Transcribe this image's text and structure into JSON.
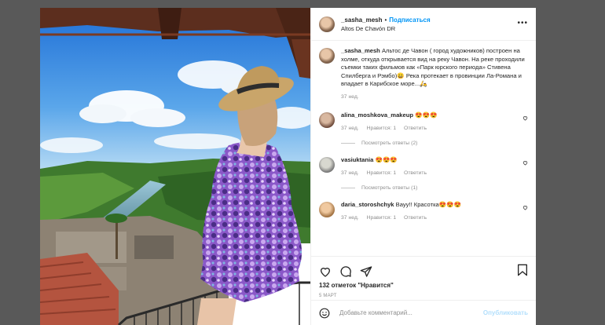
{
  "post": {
    "username": "_sasha_mesh",
    "follow_label": "Подписаться",
    "location": "Altos De Chavón DR",
    "more_icon": "more-icon"
  },
  "caption": {
    "username": "_sasha_mesh",
    "text": "Альтос де Чавон ( город художников) построен на холме, откуда открывается вид на реку Чавон. На реке проходили съемки таких фильмов как «Парк юрского периода» Стивена Спилберга и Рэмбо)😄 Река протекает в провинции Ла-Романа и впадает в Карибское море...🛵",
    "time": "37 нед."
  },
  "comments": [
    {
      "username": "alina_moshkova_makeup",
      "text": "😍😍😍",
      "time": "37 нед.",
      "likes": "Нравится: 1",
      "reply": "Ответить",
      "replies": "Посмотреть ответы (2)"
    },
    {
      "username": "vasiuktania",
      "text": "😍😍😍",
      "time": "37 нед.",
      "likes": "Нравится: 1",
      "reply": "Ответить",
      "replies": "Посмотреть ответы (1)"
    },
    {
      "username": "daria_storoshchyk",
      "text": "Вауу!! Красотка😍😍😍",
      "time": "37 нед.",
      "likes": "Нравится: 1",
      "reply": "Ответить"
    }
  ],
  "actions": {
    "likes": "132 отметок \"Нравится\"",
    "date": "5 МАРТ"
  },
  "add_comment": {
    "placeholder": "Добавьте комментарий...",
    "publish": "Опубликовать"
  },
  "colors": {
    "accent": "#0095f6",
    "publish_disabled": "#b2dffc",
    "backdrop": "#595959"
  }
}
